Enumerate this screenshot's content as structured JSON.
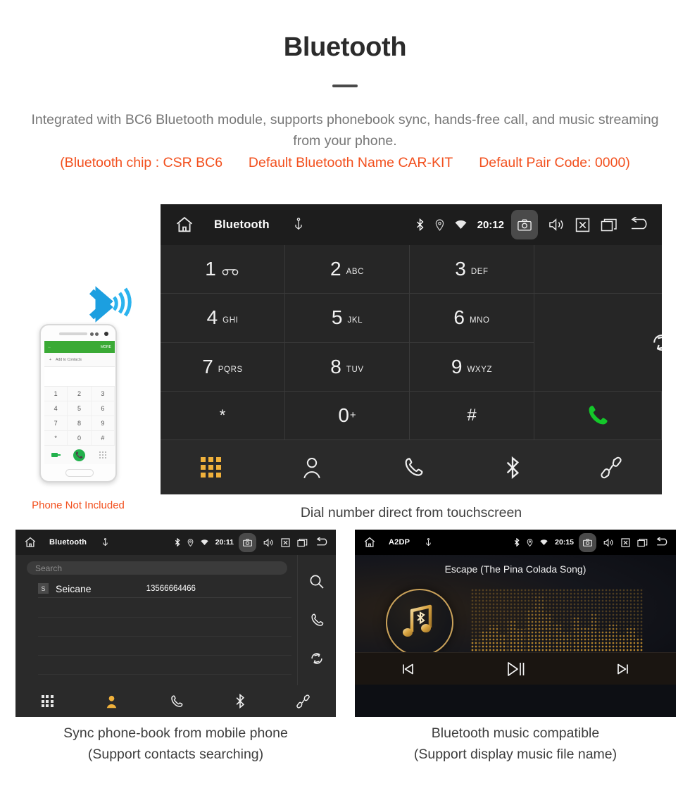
{
  "header": {
    "title": "Bluetooth",
    "subtitle": "Integrated with BC6 Bluetooth module, supports phonebook sync, hands-free call, and music streaming from your phone.",
    "spec_chip": "(Bluetooth chip : CSR BC6",
    "spec_name": "Default Bluetooth Name CAR-KIT",
    "spec_pair": "Default Pair Code: 0000)",
    "accent_color": "#f2501e",
    "text_color": "#777777"
  },
  "dialer": {
    "statusbar": {
      "home_icon": "home-icon",
      "title": "Bluetooth",
      "usb_icon": "usb-icon",
      "bluetooth_icon": "bluetooth-icon",
      "location_icon": "location-icon",
      "wifi_icon": "wifi-icon",
      "time": "20:12",
      "camera_icon": "camera-icon",
      "volume_icon": "volume-icon",
      "close_icon": "close-box-icon",
      "recents_icon": "recent-apps-icon",
      "back_icon": "back-icon"
    },
    "keys": [
      {
        "digit": "1",
        "letters": "",
        "voicemail": true
      },
      {
        "digit": "2",
        "letters": "ABC"
      },
      {
        "digit": "3",
        "letters": "DEF"
      },
      {
        "digit": "4",
        "letters": "GHI"
      },
      {
        "digit": "5",
        "letters": "JKL"
      },
      {
        "digit": "6",
        "letters": "MNO"
      },
      {
        "digit": "7",
        "letters": "PQRS"
      },
      {
        "digit": "8",
        "letters": "TUV"
      },
      {
        "digit": "9",
        "letters": "WXYZ"
      },
      {
        "digit": "*",
        "letters": ""
      },
      {
        "digit": "0",
        "letters": "",
        "plus": "+"
      },
      {
        "digit": "#",
        "letters": ""
      }
    ],
    "actions": {
      "backspace_icon": "backspace-icon",
      "sync_icon": "sync-icon",
      "call_icon": "call-icon",
      "hangup_icon": "hangup-icon",
      "call_color": "#14c82a",
      "hangup_color": "#e8361a"
    },
    "navbar": [
      {
        "name": "keypad-icon",
        "active": true
      },
      {
        "name": "contacts-icon",
        "active": false
      },
      {
        "name": "call-history-icon",
        "active": false
      },
      {
        "name": "bluetooth-icon",
        "active": false
      },
      {
        "name": "pair-link-icon",
        "active": false
      }
    ],
    "active_color": "#f0b13b",
    "caption": "Dial number direct from touchscreen"
  },
  "phone_mock": {
    "top_bar_more": "MORE",
    "add_contacts": "Add to Contacts",
    "keys": [
      "1",
      "2",
      "3",
      "4",
      "5",
      "6",
      "7",
      "8",
      "9",
      "*",
      "0",
      "#"
    ],
    "caption": "Phone Not Included",
    "caption_color": "#f2501e",
    "header_color": "#3aaa35"
  },
  "phonebook": {
    "statusbar": {
      "home_icon": "home-icon",
      "title": "Bluetooth",
      "usb_icon": "usb-icon",
      "time": "20:11",
      "camera_icon": "camera-icon",
      "volume_icon": "volume-icon",
      "close_icon": "close-box-icon",
      "recents_icon": "recent-apps-icon",
      "back_icon": "back-icon"
    },
    "search_placeholder": "Search",
    "contacts": [
      {
        "initial": "S",
        "name": "Seicane",
        "number": "13566664466"
      }
    ],
    "side_actions": [
      {
        "name": "search-icon"
      },
      {
        "name": "call-icon"
      },
      {
        "name": "sync-icon"
      }
    ],
    "navbar": [
      {
        "name": "keypad-icon",
        "active": false
      },
      {
        "name": "contacts-icon",
        "active": true
      },
      {
        "name": "call-history-icon",
        "active": false
      },
      {
        "name": "bluetooth-icon",
        "active": false
      },
      {
        "name": "pair-link-icon",
        "active": false
      }
    ],
    "caption_line1": "Sync phone-book from mobile phone",
    "caption_line2": "(Support contacts searching)"
  },
  "music": {
    "statusbar": {
      "home_icon": "home-icon",
      "title": "A2DP",
      "usb_icon": "usb-icon",
      "time": "20:15",
      "camera_icon": "camera-icon",
      "volume_icon": "volume-icon",
      "close_icon": "close-box-icon",
      "recents_icon": "recent-apps-icon",
      "back_icon": "back-icon"
    },
    "song_title": "Escape (The Pina Colada Song)",
    "album_icon": "music-note-bluetooth-icon",
    "controls": [
      {
        "name": "previous-track-button"
      },
      {
        "name": "play-pause-button"
      },
      {
        "name": "next-track-button"
      }
    ],
    "accent_color": "#d9a441",
    "caption_line1": "Bluetooth music compatible",
    "caption_line2": "(Support display music file name)"
  }
}
